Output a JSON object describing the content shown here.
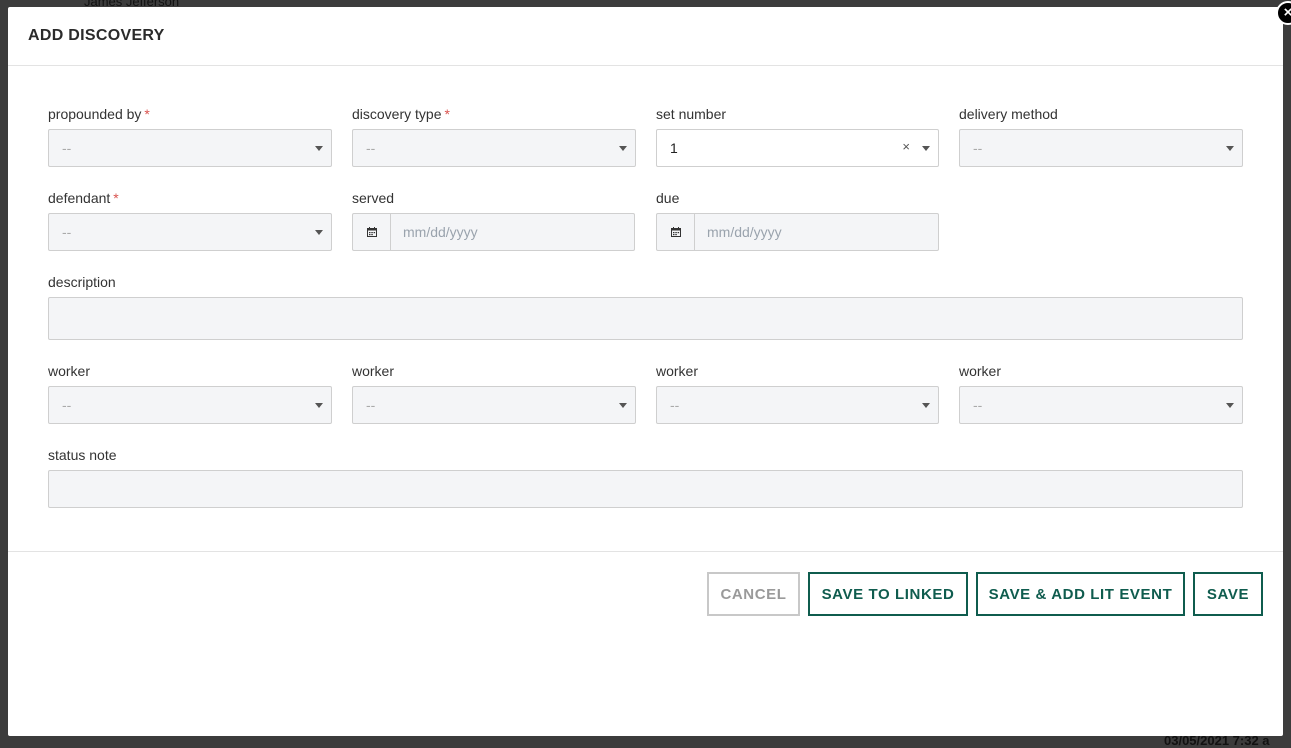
{
  "backdrop": {
    "top_name": "James Jefferson",
    "bottom_timestamp": "03/05/2021 7:32 a"
  },
  "modal": {
    "title": "ADD DISCOVERY",
    "close_glyph": "×"
  },
  "form": {
    "propounded_by": {
      "label": "propounded by",
      "required_mark": "*",
      "value": "--"
    },
    "discovery_type": {
      "label": "discovery type",
      "required_mark": "*",
      "value": "--"
    },
    "set_number": {
      "label": "set number",
      "value": "1",
      "clear_glyph": "×"
    },
    "delivery_method": {
      "label": "delivery method",
      "value": "--"
    },
    "defendant": {
      "label": "defendant",
      "required_mark": "*",
      "value": "--"
    },
    "served": {
      "label": "served",
      "placeholder": "mm/dd/yyyy",
      "icon": "calendar-icon"
    },
    "due": {
      "label": "due",
      "placeholder": "mm/dd/yyyy",
      "icon": "calendar-icon"
    },
    "description": {
      "label": "description",
      "value": ""
    },
    "workers": [
      {
        "label": "worker",
        "value": "--"
      },
      {
        "label": "worker",
        "value": "--"
      },
      {
        "label": "worker",
        "value": "--"
      },
      {
        "label": "worker",
        "value": "--"
      }
    ],
    "status_note": {
      "label": "status note",
      "value": ""
    }
  },
  "footer": {
    "cancel_label": "CANCEL",
    "save_to_linked_label": "SAVE TO LINKED",
    "save_add_lit_event_label": "SAVE & ADD LIT EVENT",
    "save_label": "SAVE"
  },
  "colors": {
    "accent": "#0f5c4e",
    "required": "#d9534f"
  }
}
